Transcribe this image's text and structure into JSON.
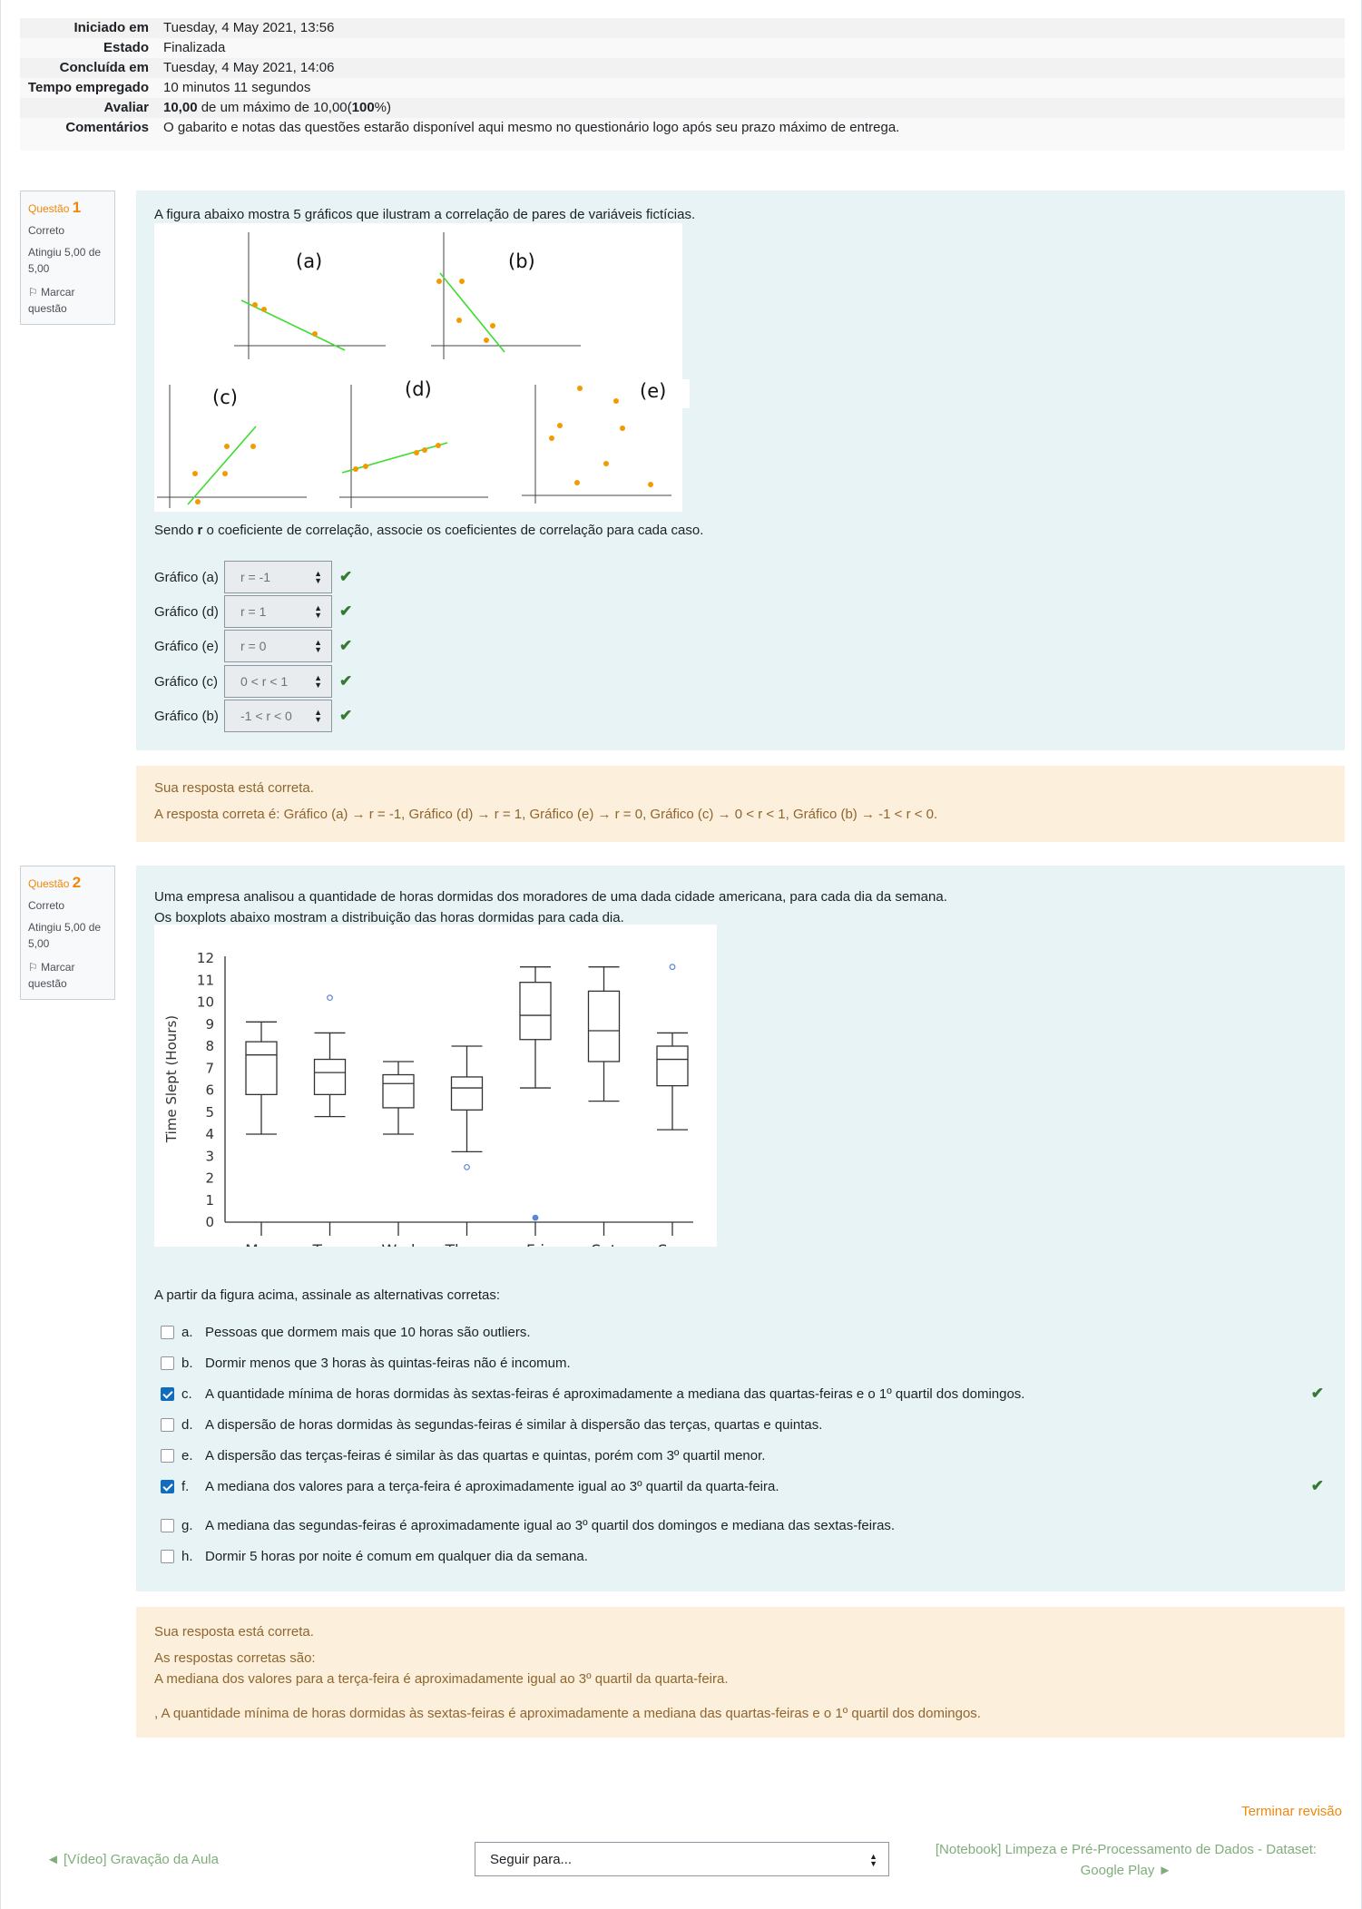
{
  "summary": {
    "rows": [
      {
        "label": "Iniciado em",
        "value": "Tuesday, 4 May 2021, 13:56"
      },
      {
        "label": "Estado",
        "value": "Finalizada"
      },
      {
        "label": "Concluída em",
        "value": "Tuesday, 4 May 2021, 14:06"
      },
      {
        "label": "Tempo empregado",
        "value": "10 minutos 11 segundos"
      }
    ],
    "grade_label": "Avaliar",
    "grade_bold": "10,00",
    "grade_mid": " de um máximo de 10,00(",
    "grade_pct": "100",
    "grade_end": "%)",
    "comments_label": "Comentários",
    "comments_value": "O gabarito e notas das questões estarão disponível aqui mesmo no questionário logo após seu prazo máximo de entrega."
  },
  "q1": {
    "prefix": "Questão ",
    "number": "1",
    "state": "Correto",
    "grade": "Atingiu 5,00 de 5,00",
    "flag": "Marcar questão",
    "text": "A figura abaixo mostra 5 gráficos que ilustram a correlação de pares de variáveis fictícias.",
    "figure_labels": [
      "(a)",
      "(b)",
      "(c)",
      "(d)",
      "(e)"
    ],
    "assoc_before": "Sendo ",
    "assoc_bold": "r",
    "assoc_after": " o coeficiente de correlação, associe os coeficientes de correlação para cada caso.",
    "matches": [
      {
        "label": "Gráfico (a)",
        "value": "r = -1"
      },
      {
        "label": "Gráfico (d)",
        "value": "r = 1"
      },
      {
        "label": "Gráfico (e)",
        "value": "r = 0"
      },
      {
        "label": "Gráfico (c)",
        "value": "0 < r < 1"
      },
      {
        "label": "Gráfico (b)",
        "value": "-1 < r < 0"
      }
    ],
    "feedback_status": "Sua resposta está correta.",
    "feedback_answer": "A resposta correta é: Gráfico (a) → r = -1, Gráfico (d) → r = 1, Gráfico (e) → r = 0, Gráfico (c) → 0 < r < 1, Gráfico (b) → -1 < r < 0."
  },
  "q2": {
    "prefix": "Questão ",
    "number": "2",
    "state": "Correto",
    "grade": "Atingiu 5,00 de 5,00",
    "flag": "Marcar questão",
    "text1": "Uma empresa analisou a quantidade de horas dormidas dos moradores de uma dada cidade americana, para cada dia da semana.",
    "text2": "Os boxplots abaixo mostram a distribuição das horas dormidas para cada dia.",
    "prompt": "A partir da figura acima, assinale as alternativas corretas:",
    "options": [
      {
        "letter": "a.",
        "text": "Pessoas que dormem mais que 10 horas são outliers.",
        "checked": false
      },
      {
        "letter": "b.",
        "text": "Dormir menos que 3 horas às quintas-feiras não é incomum.",
        "checked": false
      },
      {
        "letter": "c.",
        "text": "A quantidade mínima de horas dormidas às sextas-feiras é aproximadamente a mediana das quartas-feiras e o 1º quartil dos domingos.",
        "checked": true
      },
      {
        "letter": "d.",
        "text": "A dispersão de horas dormidas às segundas-feiras é similar à dispersão das terças, quartas e quintas.",
        "checked": false
      },
      {
        "letter": "e.",
        "text": "A dispersão das terças-feiras é similar às das quartas e quintas, porém com 3º quartil menor.",
        "checked": false
      },
      {
        "letter": "f.",
        "text": "A mediana dos valores para a terça-feira é aproximadamente igual ao 3º quartil da quarta-feira.",
        "checked": true
      },
      {
        "letter": "g.",
        "text": "A mediana das segundas-feiras é aproximadamente igual ao 3º quartil dos domingos e mediana das sextas-feiras.",
        "checked": false
      },
      {
        "letter": "h.",
        "text": "Dormir 5 horas por noite é comum em qualquer dia da semana.",
        "checked": false
      }
    ],
    "feedback_status": "Sua resposta está correta.",
    "feedback_intro": "As respostas corretas são:",
    "feedback_1": "A mediana dos valores para a terça-feira é aproximadamente igual ao 3º quartil da quarta-feira.",
    "feedback_2": ", A quantidade mínima de horas dormidas às sextas-feiras é aproximadamente a mediana das quartas-feiras e o 1º quartil dos domingos."
  },
  "chart_data": {
    "type": "boxplot",
    "ylabel": "Time Slept (Hours)",
    "ylim": [
      0,
      12
    ],
    "yticks": [
      "0",
      "1",
      "2",
      "3",
      "4",
      "5",
      "6",
      "7",
      "8",
      "9",
      "10",
      "11",
      "12"
    ],
    "categories": [
      "Mon",
      "Tues",
      "Wed",
      "Thurs",
      "Fri",
      "Sat",
      "Sun"
    ],
    "boxes": [
      {
        "min": 4.0,
        "q1": 5.8,
        "median": 7.6,
        "q3": 8.2,
        "max": 9.1,
        "outliers": []
      },
      {
        "min": 4.8,
        "q1": 5.8,
        "median": 6.8,
        "q3": 7.4,
        "max": 8.6,
        "outliers": [
          10.2
        ]
      },
      {
        "min": 4.0,
        "q1": 5.2,
        "median": 6.3,
        "q3": 6.7,
        "max": 7.3,
        "outliers": []
      },
      {
        "min": 3.2,
        "q1": 5.1,
        "median": 6.1,
        "q3": 6.6,
        "max": 8.0,
        "outliers": [
          2.5
        ]
      },
      {
        "min": 6.1,
        "q1": 8.3,
        "median": 9.4,
        "q3": 10.9,
        "max": 11.6,
        "outliers": [
          0.2
        ]
      },
      {
        "min": 5.5,
        "q1": 7.3,
        "median": 8.7,
        "q3": 10.5,
        "max": 11.6,
        "outliers": []
      },
      {
        "min": 4.2,
        "q1": 6.2,
        "median": 7.4,
        "q3": 8.0,
        "max": 8.6,
        "outliers": [
          11.6
        ]
      }
    ]
  },
  "footer": {
    "finish": "Terminar revisão",
    "prev": "◄ [Vídeo] Gravação da Aula",
    "jump": "Seguir para...",
    "next": "[Notebook] Limpeza e Pré-Processamento de Dados - Dataset: Google Play ►"
  },
  "colors": {
    "accent": "#f0870a",
    "correct": "#357a32",
    "question_bg": "#e7f3f5",
    "feedback_bg": "#fcefdc"
  }
}
